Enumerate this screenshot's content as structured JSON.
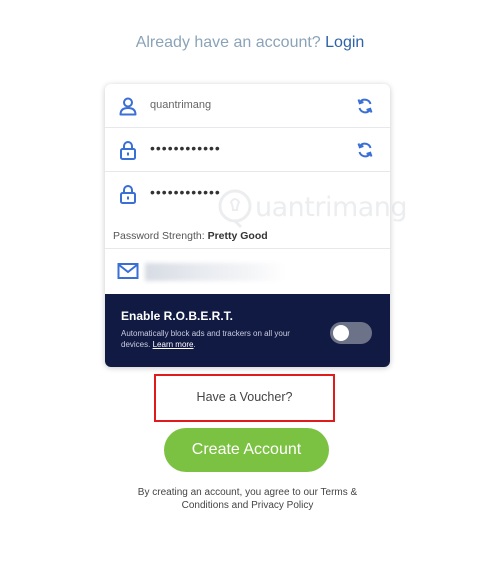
{
  "header": {
    "prompt": "Already have an account?",
    "login_link": "Login"
  },
  "form": {
    "username": "quantrimang",
    "password_mask": "••••••••••••",
    "confirm_mask": "••••••••••••",
    "strength_label": "Password Strength:",
    "strength_value": "Pretty Good"
  },
  "robert": {
    "title": "Enable R.O.B.E.R.T.",
    "description": "Automatically block ads and trackers on all your devices.",
    "learn_more": "Learn more",
    "toggle_on": false
  },
  "voucher": {
    "label": "Have a Voucher?"
  },
  "create_button": {
    "label": "Create Account"
  },
  "terms": {
    "text": "By creating an account, you agree to our Terms & Conditions and Privacy Policy"
  },
  "watermark": {
    "text": "uantrimang"
  },
  "colors": {
    "accent": "#2f63a8",
    "icon_blue": "#3a6fd6",
    "button_green": "#7cc242",
    "dark_panel": "#111a43",
    "highlight_red": "#e01b1b"
  }
}
